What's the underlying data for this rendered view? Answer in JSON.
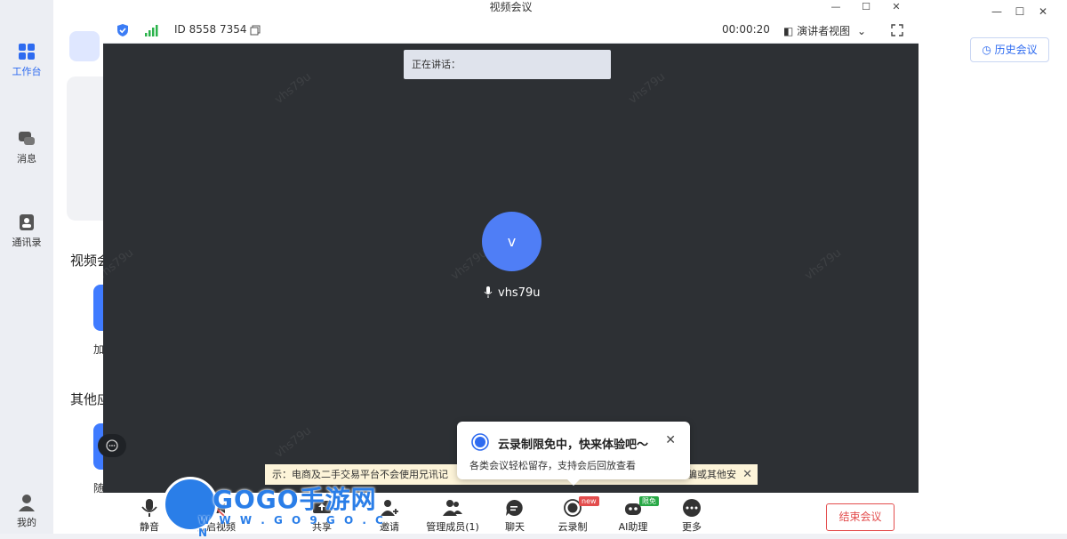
{
  "sidebar": {
    "workbench": "工作台",
    "messages": "消息",
    "contacts": "通讯录",
    "me": "我的"
  },
  "background": {
    "section1": "视频会",
    "section2": "其他应",
    "tile1_label": "加",
    "tile2_label": "随",
    "history_button": "历史会议"
  },
  "meeting": {
    "title": "视频会议",
    "window_controls": [
      "—",
      "☐",
      "✕"
    ],
    "meeting_id": "ID 8558 7354",
    "timer": "00:00:20",
    "view_mode": "演讲者视图",
    "speaking_label": "正在讲话：",
    "watermark": "vhs79u",
    "participant_initial": "v",
    "participant_name": "vhs79u"
  },
  "notice": {
    "text": "示：电商及二手交易平台不会使用兄讯记",
    "tail": "骗或其他安"
  },
  "promo": {
    "title": "云录制限免中，快来体验吧～",
    "description": "各类会议轻松留存，支持会后回放查看"
  },
  "toolbar": {
    "mute": "静音",
    "video": "开启视频",
    "share": "共享",
    "invite": "邀请",
    "members": "管理成员(1)",
    "chat": "聊天",
    "record": "云录制",
    "record_badge": "new",
    "ai": "AI助理",
    "ai_badge": "限免",
    "more": "更多",
    "end": "结束会议"
  },
  "site_logo": {
    "name": "GOGO手游网",
    "url": "W W W . G O 9 G O . C N"
  },
  "colors": {
    "accent": "#2e6bf0",
    "meeting_bg": "#2d3034",
    "avatar": "#4f7ef6",
    "end_button": "#e34d4d",
    "new_badge": "#e34d4d",
    "free_badge": "#27a845"
  }
}
